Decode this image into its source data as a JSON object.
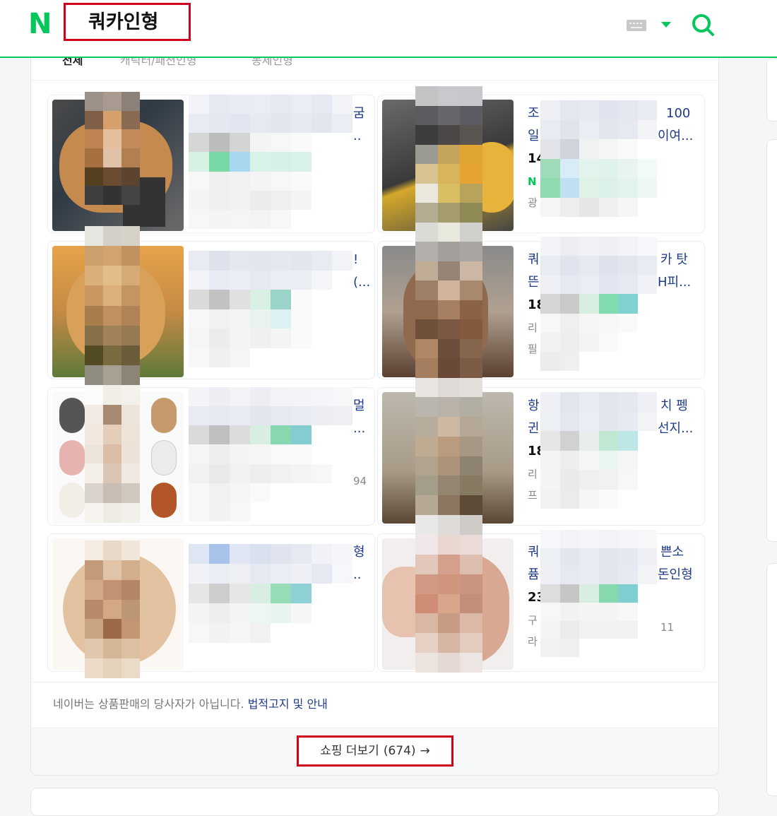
{
  "search": {
    "query": "쿼카인형"
  },
  "header": {
    "logo": "N"
  },
  "tabs": [
    {
      "label": "전체",
      "active": true
    },
    {
      "label": "캐릭터/패션인형",
      "active": false
    },
    {
      "label": "봉제인형",
      "active": false
    }
  ],
  "products": [
    {
      "line1": "",
      "line2": "",
      "line3": "",
      "line4": "",
      "line5": "",
      "visible_fragment1": "굼",
      "visible_fragment2": ".."
    },
    {
      "line1": "조",
      "line2": "일",
      "line3": "14",
      "line4": "N",
      "line5": "광",
      "visible_fragment1": "100",
      "visible_fragment2": "이여..."
    },
    {
      "line1": "",
      "line2": "",
      "line3": "",
      "line4": "",
      "line5": "",
      "visible_fragment1": "!",
      "visible_fragment2": "(..."
    },
    {
      "line1": "쿼",
      "line2": "뜬",
      "line3": "18",
      "line4": "리",
      "line5": "필",
      "visible_fragment1": "카 탓",
      "visible_fragment2": "H피..."
    },
    {
      "line1": "",
      "line2": "",
      "line3": "",
      "line4": "",
      "line5": "",
      "visible_fragment1": "멀",
      "visible_fragment2": "...",
      "visible_fragment3": "94"
    },
    {
      "line1": "항",
      "line2": "귄",
      "line3": "18",
      "line4": "리",
      "line5": "프",
      "visible_fragment1": "치 펭",
      "visible_fragment2": "선지..."
    },
    {
      "line1": "",
      "line2": "",
      "line3": "",
      "line4": "",
      "line5": "",
      "visible_fragment1": "형",
      "visible_fragment2": ".."
    },
    {
      "line1": "쿼",
      "line2": "퓸",
      "line3": "23",
      "line4": "구",
      "line5": "라",
      "visible_fragment1": "쁜소",
      "visible_fragment2": "돈인형",
      "visible_fragment3": "11"
    }
  ],
  "notice": {
    "text": "네이버는 상품판매의 당사자가 아닙니다.",
    "link": "법적고지 및 안내"
  },
  "more_button": {
    "label": "쇼핑 더보기",
    "count": "(674)",
    "arrow": "→"
  },
  "icons": {
    "keyboard": "keyboard-icon",
    "dropdown": "triangle-down-icon",
    "search": "search-icon"
  },
  "colors": {
    "brand": "#03c75a",
    "highlight": "#d0021b",
    "link": "#1e3a8a"
  }
}
